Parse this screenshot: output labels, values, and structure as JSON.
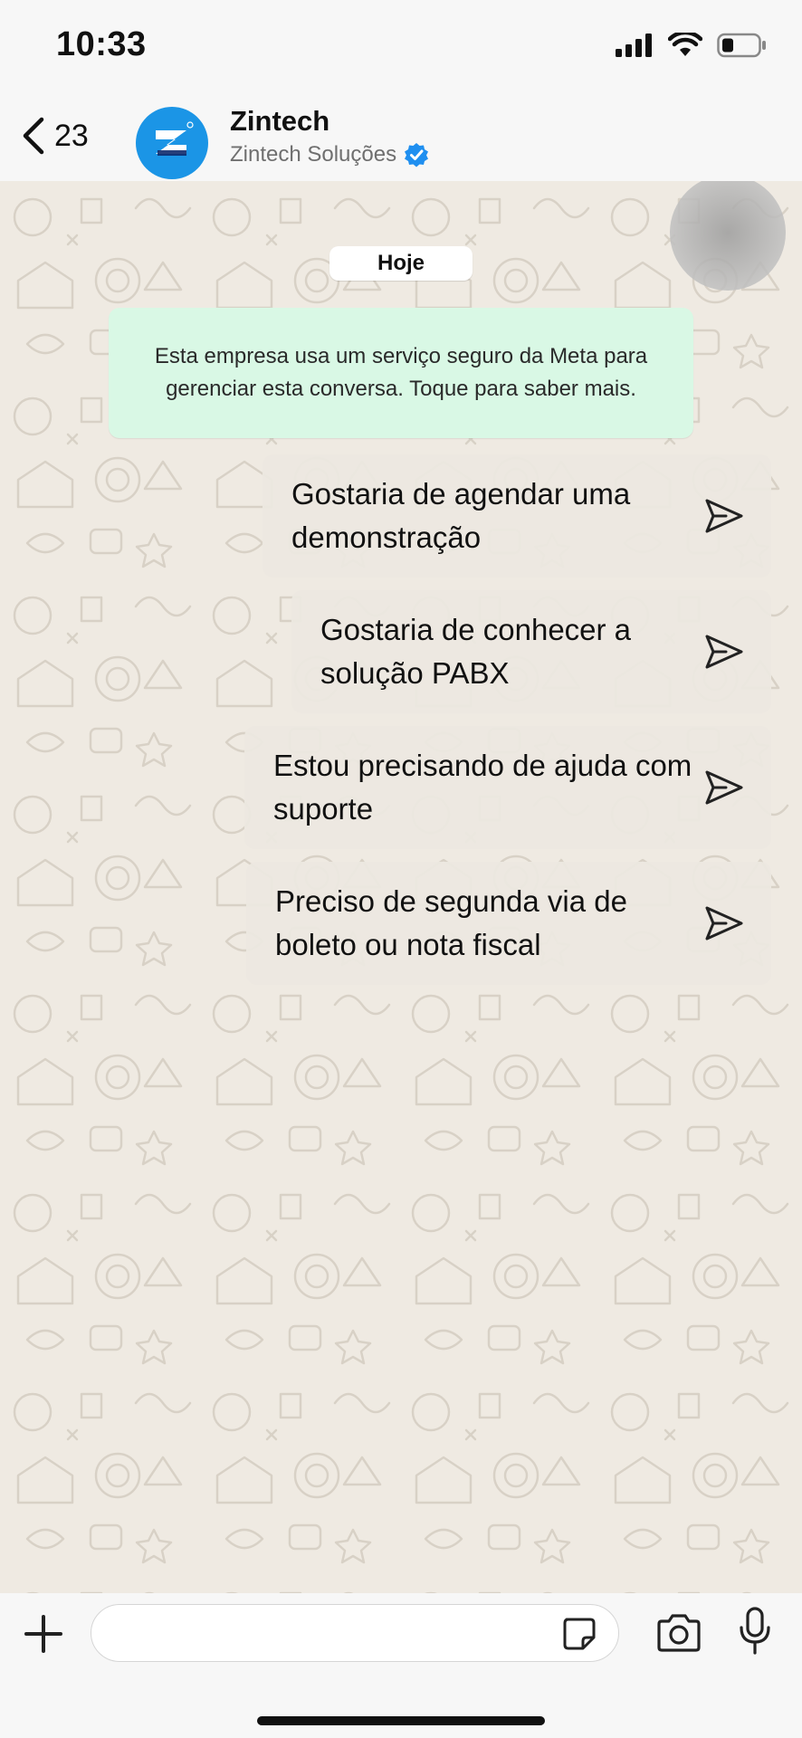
{
  "status_bar": {
    "time": "10:33"
  },
  "header": {
    "back_count": "23",
    "title": "Zintech",
    "subtitle": "Zintech Soluções",
    "brand_color": "#1b95e6",
    "verified_color": "#1f8ff0"
  },
  "chat": {
    "date_chip": "Hoje",
    "meta_notice": "Esta empresa usa um serviço seguro da Meta para gerenciar esta conversa. Toque para saber mais.",
    "quick_replies": [
      {
        "label": "Gostaria de agendar uma demonstração"
      },
      {
        "label": "Gostaria de conhecer a solução PABX"
      },
      {
        "label": "Estou precisando de ajuda com suporte"
      },
      {
        "label": "Preciso de segunda via de boleto ou nota fiscal"
      }
    ]
  },
  "input_bar": {
    "placeholder": "",
    "icons": [
      "plus-icon",
      "sticker-icon",
      "camera-icon",
      "microphone-icon"
    ]
  }
}
